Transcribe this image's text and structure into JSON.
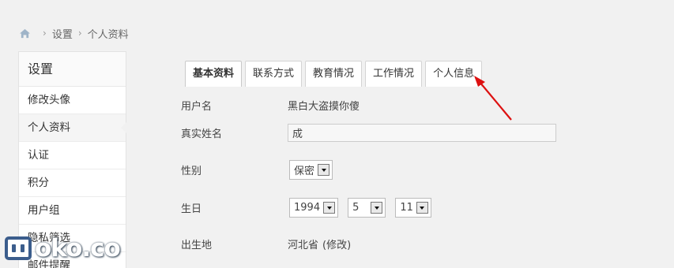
{
  "breadcrumb": {
    "home_icon": "home-icon",
    "items": [
      "设置",
      "个人资料"
    ]
  },
  "sidebar": {
    "title": "设置",
    "items": [
      {
        "label": "修改头像",
        "active": false
      },
      {
        "label": "个人资料",
        "active": true
      },
      {
        "label": "认证",
        "active": false
      },
      {
        "label": "积分",
        "active": false
      },
      {
        "label": "用户组",
        "active": false
      },
      {
        "label": "隐私筛选",
        "active": false
      },
      {
        "label": "邮件提醒",
        "active": false
      }
    ]
  },
  "tabs": [
    {
      "label": "基本资料",
      "active": true
    },
    {
      "label": "联系方式",
      "active": false
    },
    {
      "label": "教育情况",
      "active": false
    },
    {
      "label": "工作情况",
      "active": false
    },
    {
      "label": "个人信息",
      "active": false
    }
  ],
  "form": {
    "username_label": "用户名",
    "username_value": "黑白大盗摸你傻",
    "realname_label": "真实姓名",
    "realname_value": "成",
    "gender_label": "性别",
    "gender_value": "保密",
    "birthday_label": "生日",
    "birth_year": "1994",
    "birth_month": "5",
    "birth_day": "11",
    "birthplace_label": "出生地",
    "birthplace_value": "河北省",
    "birthplace_edit": "(修改)"
  },
  "annotation": {
    "color": "#dd1111"
  },
  "watermark": {
    "text": "oko.co"
  },
  "colors": {
    "accent": "#3b5d8c",
    "background": "#f1f1f1"
  }
}
